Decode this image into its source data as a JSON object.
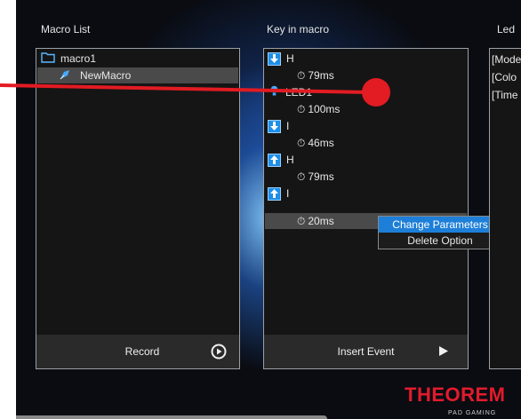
{
  "columns": {
    "macro_list": "Macro List",
    "key_in_macro": "Key in macro",
    "led": "Led"
  },
  "macro_list": {
    "items": [
      {
        "label": "macro1",
        "icon": "folder-icon"
      },
      {
        "label": "NewMacro",
        "icon": "macro-file-icon",
        "selected": true
      }
    ],
    "record_label": "Record"
  },
  "key_list": {
    "entries": [
      {
        "type": "key",
        "direction": "down",
        "label": "H"
      },
      {
        "type": "delay",
        "label": "79ms"
      },
      {
        "type": "led",
        "label": "LED1"
      },
      {
        "type": "delay",
        "label": "100ms"
      },
      {
        "type": "key",
        "direction": "down",
        "label": "I"
      },
      {
        "type": "delay",
        "label": "46ms"
      },
      {
        "type": "key",
        "direction": "up",
        "label": "H"
      },
      {
        "type": "delay",
        "label": "79ms"
      },
      {
        "type": "key",
        "direction": "up",
        "label": "I"
      },
      {
        "type": "delay",
        "label": "20ms",
        "selected": true
      }
    ],
    "insert_label": "Insert Event"
  },
  "context_menu": {
    "items": [
      "Change Parameters",
      "Delete Option"
    ]
  },
  "led_panel": {
    "lines": [
      "[Mode",
      "[Colo",
      "[Time"
    ]
  },
  "brand": {
    "logo_text": "THEOREM",
    "sub_text": "PAD GAMING"
  },
  "colors": {
    "accent": "#1e7fd8",
    "brand_red": "#e21b2c",
    "pointer": "#e31b23"
  }
}
